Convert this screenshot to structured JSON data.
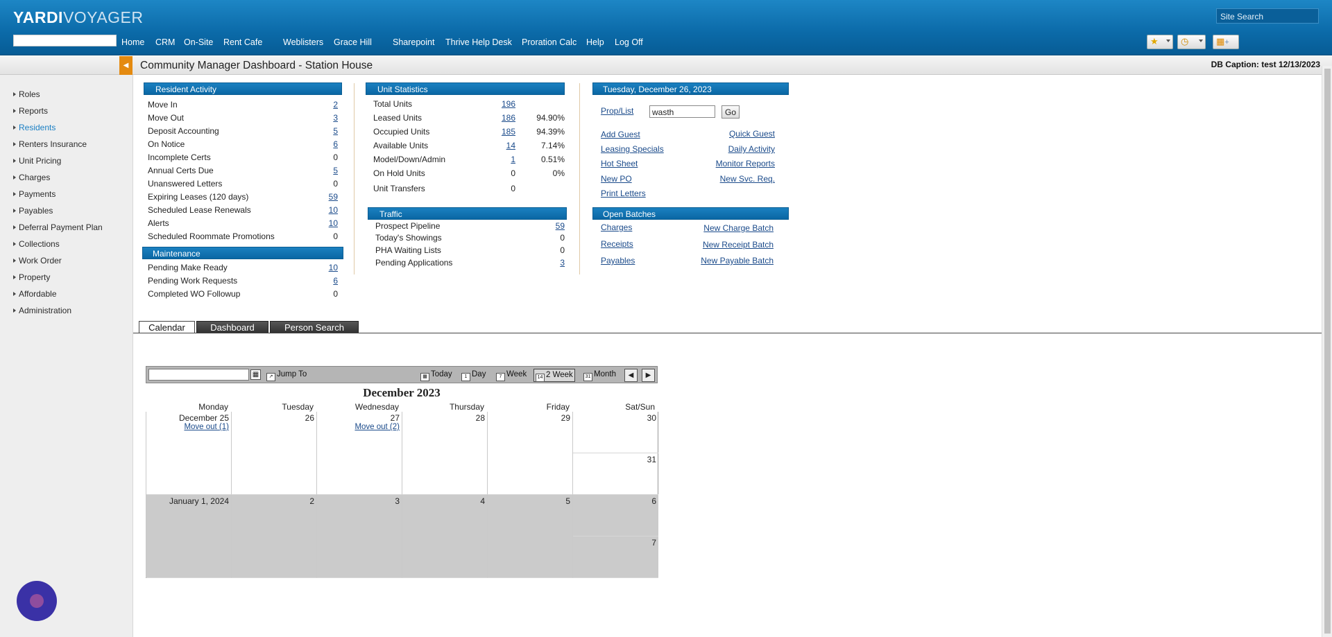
{
  "header": {
    "logo_a": "YARDI",
    "logo_b": "VOYAGER",
    "site_search_placeholder": "Site Search",
    "nav": [
      "Home",
      "CRM",
      "On-Site",
      "Rent Cafe",
      "Weblisters",
      "Grace Hill",
      "Sharepoint",
      "Thrive Help Desk",
      "Proration Calc",
      "Help",
      "Log Off"
    ]
  },
  "titlebar": {
    "title": "Community Manager Dashboard - Station House",
    "db_caption": "DB Caption: test 12/13/2023"
  },
  "sidebar": {
    "items": [
      "Roles",
      "Reports",
      "Residents",
      "Renters Insurance",
      "Unit Pricing",
      "Charges",
      "Payments",
      "Payables",
      "Deferral Payment Plan",
      "Collections",
      "Work Order",
      "Property",
      "Affordable",
      "Administration"
    ],
    "active": "Residents"
  },
  "resident_activity": {
    "title": "Resident Activity",
    "rows": [
      {
        "label": "Move In",
        "value": "2",
        "link": true
      },
      {
        "label": "Move Out",
        "value": "3",
        "link": true
      },
      {
        "label": "Deposit Accounting",
        "value": "5",
        "link": true
      },
      {
        "label": "On Notice",
        "value": "6",
        "link": true
      },
      {
        "label": "Incomplete Certs",
        "value": "0",
        "link": false
      },
      {
        "label": "Annual Certs Due",
        "value": "5",
        "link": true
      },
      {
        "label": "Unanswered Letters",
        "value": "0",
        "link": false
      },
      {
        "label": "Expiring Leases (120 days)",
        "value": "59",
        "link": true
      },
      {
        "label": "Scheduled Lease Renewals",
        "value": "10",
        "link": true
      },
      {
        "label": "Alerts",
        "value": "10",
        "link": true
      },
      {
        "label": "Scheduled Roommate Promotions",
        "value": "0",
        "link": false
      }
    ]
  },
  "maintenance": {
    "title": "Maintenance",
    "rows": [
      {
        "label": "Pending Make Ready",
        "value": "10",
        "link": true
      },
      {
        "label": "Pending Work Requests",
        "value": "6",
        "link": true
      },
      {
        "label": "Completed WO Followup",
        "value": "0",
        "link": false
      }
    ]
  },
  "unit_statistics": {
    "title": "Unit Statistics",
    "rows": [
      {
        "label": "Total Units",
        "value": "196",
        "link": true,
        "pct": ""
      },
      {
        "label": "Leased Units",
        "value": "186",
        "link": true,
        "pct": "94.90%"
      },
      {
        "label": "Occupied Units",
        "value": "185",
        "link": true,
        "pct": "94.39%"
      },
      {
        "label": "Available Units",
        "value": "14",
        "link": true,
        "pct": "7.14%"
      },
      {
        "label": "Model/Down/Admin",
        "value": "1",
        "link": true,
        "pct": "0.51%"
      },
      {
        "label": "On Hold Units",
        "value": "0",
        "link": false,
        "pct": "0%"
      },
      {
        "label": "Unit Transfers",
        "value": "0",
        "link": false,
        "pct": ""
      }
    ]
  },
  "traffic": {
    "title": "Traffic",
    "rows": [
      {
        "label": "Prospect Pipeline",
        "value": "59",
        "link": true
      },
      {
        "label": "Today's Showings",
        "value": "0",
        "link": false
      },
      {
        "label": "PHA Waiting Lists",
        "value": "0",
        "link": false
      },
      {
        "label": "Pending Applications",
        "value": "3",
        "link": true
      }
    ]
  },
  "date_panel": {
    "title": "Tuesday, December 26, 2023",
    "prop_list_label": "Prop/List",
    "prop_list_value": "wasth",
    "go_label": "Go",
    "links_left": [
      "Add Guest",
      "Leasing Specials",
      "Hot Sheet",
      "New PO",
      "Print Letters"
    ],
    "links_right": [
      "Quick Guest",
      "Daily Activity",
      "Monitor Reports",
      "New Svc. Req."
    ]
  },
  "open_batches": {
    "title": "Open Batches",
    "links_left": [
      "Charges",
      "Receipts",
      "Payables"
    ],
    "links_right": [
      "New Charge Batch",
      "New Receipt Batch",
      "New Payable Batch"
    ]
  },
  "tabs": [
    "Calendar",
    "Dashboard",
    "Person Search"
  ],
  "calendar": {
    "jump_to": "Jump To",
    "views": [
      "Today",
      "Day",
      "Week",
      "2 Week",
      "Month"
    ],
    "selected_view": "2 Week",
    "month_title": "December 2023",
    "days_of_week": [
      "Monday",
      "Tuesday",
      "Wednesday",
      "Thursday",
      "Friday",
      "Sat/Sun"
    ],
    "week1": [
      "December 25",
      "26",
      "27",
      "28",
      "29",
      "30",
      "31"
    ],
    "week2": [
      "January 1, 2024",
      "2",
      "3",
      "4",
      "5",
      "6",
      "7"
    ],
    "events": {
      "mon": "Move out (1)",
      "wed": "Move out (2)"
    }
  }
}
